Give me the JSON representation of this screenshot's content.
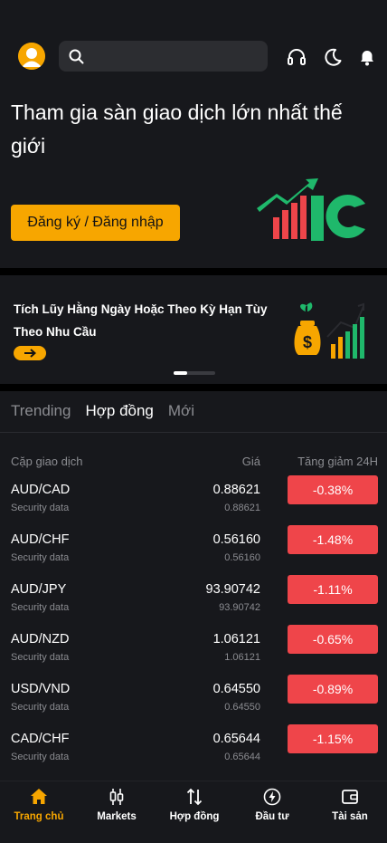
{
  "colors": {
    "accent": "#f7a600",
    "negative": "#ef454a",
    "panel": "#17181c",
    "muted": "#8b8c91"
  },
  "header": {
    "avatar_icon": "user-avatar-icon",
    "search_placeholder": "",
    "icons": [
      "headset-icon",
      "moon-icon",
      "bell-icon"
    ]
  },
  "hero": {
    "title": "Tham gia sàn giao dịch lớn nhất thế giới",
    "cta_label": "Đăng ký / Đăng nhập"
  },
  "promo": {
    "text": "Tích Lũy Hằng Ngày Hoặc Theo Kỳ Hạn Tùy Theo Nhu Cầu",
    "arrow_icon": "arrow-right-icon",
    "slide_index": 1,
    "slide_count": 3
  },
  "market": {
    "tabs": [
      {
        "label": "Trending",
        "active": false
      },
      {
        "label": "Hợp đồng",
        "active": true
      },
      {
        "label": "Mới",
        "active": false
      }
    ],
    "columns": {
      "pair": "Cặp giao dịch",
      "price": "Giá",
      "change": "Tăng giảm 24H"
    },
    "rows": [
      {
        "pair": "AUD/CAD",
        "sub": "Security data",
        "price": "0.88621",
        "price_sub": "0.88621",
        "change": "-0.38%"
      },
      {
        "pair": "AUD/CHF",
        "sub": "Security data",
        "price": "0.56160",
        "price_sub": "0.56160",
        "change": "-1.48%"
      },
      {
        "pair": "AUD/JPY",
        "sub": "Security data",
        "price": "93.90742",
        "price_sub": "93.90742",
        "change": "-1.11%"
      },
      {
        "pair": "AUD/NZD",
        "sub": "Security data",
        "price": "1.06121",
        "price_sub": "1.06121",
        "change": "-0.65%"
      },
      {
        "pair": "USD/VND",
        "sub": "Security data",
        "price": "0.64550",
        "price_sub": "0.64550",
        "change": "-0.89%"
      },
      {
        "pair": "CAD/CHF",
        "sub": "Security data",
        "price": "0.65644",
        "price_sub": "0.65644",
        "change": "-1.15%"
      }
    ]
  },
  "nav": [
    {
      "label": "Trang chủ",
      "icon": "home-icon",
      "active": true
    },
    {
      "label": "Markets",
      "icon": "candlestick-icon",
      "active": false
    },
    {
      "label": "Hợp đồng",
      "icon": "swap-vertical-icon",
      "active": false
    },
    {
      "label": "Đầu tư",
      "icon": "lightning-icon",
      "active": false
    },
    {
      "label": "Tài sản",
      "icon": "wallet-icon",
      "active": false
    }
  ]
}
